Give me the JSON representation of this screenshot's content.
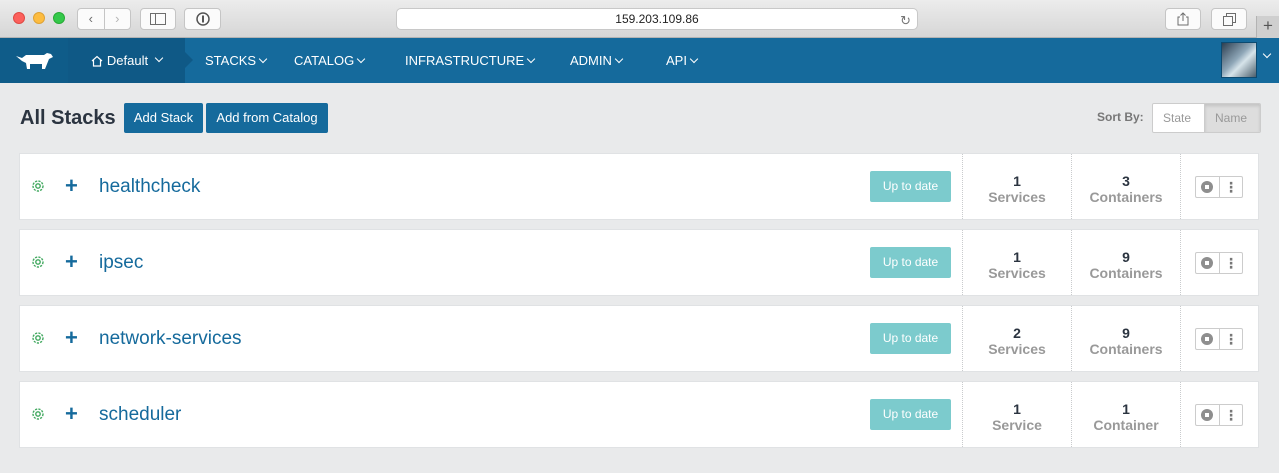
{
  "browser": {
    "url": "159.203.109.86",
    "back_glyph": "‹",
    "forward_glyph": "›",
    "new_tab_glyph": "+"
  },
  "nav": {
    "environment": "Default",
    "items": [
      {
        "label": "STACKS"
      },
      {
        "label": "CATALOG"
      },
      {
        "label": "INFRASTRUCTURE"
      },
      {
        "label": "ADMIN"
      },
      {
        "label": "API"
      }
    ]
  },
  "page": {
    "title": "All Stacks",
    "add_stack_label": "Add Stack",
    "add_from_catalog_label": "Add from Catalog",
    "sort_by_label": "Sort By:",
    "sort_options": [
      "State",
      "Name"
    ],
    "sort_selected": "Name"
  },
  "stacks": [
    {
      "name": "healthcheck",
      "status": "Up to date",
      "services_count": "1",
      "services_unit": "Services",
      "containers_count": "3",
      "containers_unit": "Containers"
    },
    {
      "name": "ipsec",
      "status": "Up to date",
      "services_count": "1",
      "services_unit": "Services",
      "containers_count": "9",
      "containers_unit": "Containers"
    },
    {
      "name": "network-services",
      "status": "Up to date",
      "services_count": "2",
      "services_unit": "Services",
      "containers_count": "9",
      "containers_unit": "Containers"
    },
    {
      "name": "scheduler",
      "status": "Up to date",
      "services_count": "1",
      "services_unit": "Service",
      "containers_count": "1",
      "containers_unit": "Container"
    }
  ],
  "colors": {
    "brand": "#156a9c",
    "status_ok": "#7ccbcd",
    "health_green": "#41a85f"
  }
}
